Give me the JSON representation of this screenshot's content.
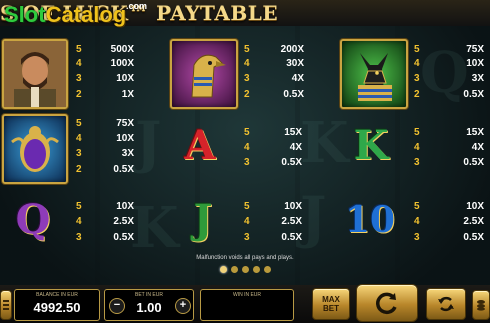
{
  "header": {
    "title_visible": "S OF LUCK™ PAYTABLE",
    "title_tail": "BOOKS OF LUCK"
  },
  "watermark": {
    "slot": "Slot",
    "catalog": "Catalog",
    "com": ".com"
  },
  "paytable": [
    {
      "symbol": "explorer",
      "pays": [
        [
          "5",
          "500X"
        ],
        [
          "4",
          "100X"
        ],
        [
          "3",
          "10X"
        ],
        [
          "2",
          "1X"
        ]
      ]
    },
    {
      "symbol": "falcon",
      "pays": [
        [
          "5",
          "200X"
        ],
        [
          "4",
          "30X"
        ],
        [
          "3",
          "4X"
        ],
        [
          "2",
          "0.5X"
        ]
      ]
    },
    {
      "symbol": "anubis",
      "pays": [
        [
          "5",
          "75X"
        ],
        [
          "4",
          "10X"
        ],
        [
          "3",
          "3X"
        ],
        [
          "2",
          "0.5X"
        ]
      ]
    },
    {
      "symbol": "scarab",
      "pays": [
        [
          "5",
          "75X"
        ],
        [
          "4",
          "10X"
        ],
        [
          "3",
          "3X"
        ],
        [
          "2",
          "0.5X"
        ]
      ]
    },
    {
      "symbol": "A",
      "pays": [
        [
          "5",
          "15X"
        ],
        [
          "4",
          "4X"
        ],
        [
          "3",
          "0.5X"
        ]
      ]
    },
    {
      "symbol": "K",
      "pays": [
        [
          "5",
          "15X"
        ],
        [
          "4",
          "4X"
        ],
        [
          "3",
          "0.5X"
        ]
      ]
    },
    {
      "symbol": "Q",
      "pays": [
        [
          "5",
          "10X"
        ],
        [
          "4",
          "2.5X"
        ],
        [
          "3",
          "0.5X"
        ]
      ]
    },
    {
      "symbol": "J",
      "pays": [
        [
          "5",
          "10X"
        ],
        [
          "4",
          "2.5X"
        ],
        [
          "3",
          "0.5X"
        ]
      ]
    },
    {
      "symbol": "10",
      "pays": [
        [
          "5",
          "10X"
        ],
        [
          "4",
          "2.5X"
        ],
        [
          "3",
          "0.5X"
        ]
      ]
    }
  ],
  "note": "Malfunction voids all pays and plays.",
  "pagination": {
    "pages": 5,
    "active": 1
  },
  "controls": {
    "balance_label": "BALANCE IN EUR",
    "balance_value": "4992.50",
    "bet_label": "BET IN EUR",
    "bet_value": "1.00",
    "win_label": "WIN IN EUR",
    "win_value": "",
    "minus": "−",
    "plus": "+",
    "max_bet_top": "MAX",
    "max_bet_bottom": "BET",
    "icons": [
      "menu-icon",
      "coins-icon",
      "spin-icon",
      "autoplay-icon"
    ]
  },
  "colors": {
    "gold": "#c9a441",
    "count_yellow": "#f2c230",
    "A": "#d6232a",
    "K": "#2fa84a",
    "Q": "#8e3bb8",
    "J": "#2f9a3a",
    "10": "#1f6fd4"
  }
}
